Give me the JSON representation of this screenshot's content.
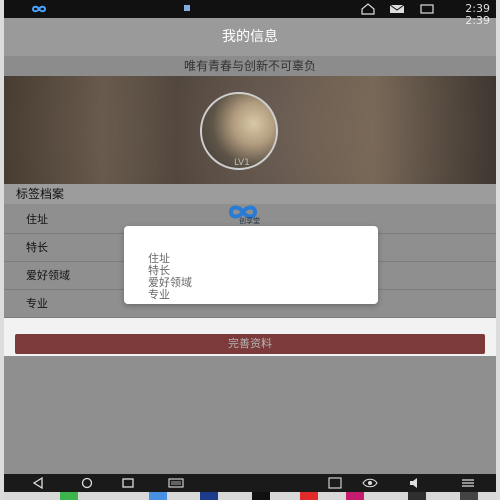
{
  "status_bar": {
    "time": "2:39"
  },
  "header": {
    "title": "我的信息",
    "subtitle_time": "2:39"
  },
  "slogan": "唯有青春与创新不可辜负",
  "profile": {
    "level": "LV1"
  },
  "tags_section": {
    "title": "标签档案",
    "rows": [
      "住址",
      "特长",
      "爱好领域",
      "专业"
    ]
  },
  "actions": {
    "complete_label": "完善资料"
  },
  "center_logo": {
    "text": "创享堂"
  },
  "dialog": {
    "items": [
      "住址",
      "特长",
      "爱好领域",
      "专业"
    ]
  },
  "icons": {
    "status": [
      "home-icon",
      "mail-icon",
      "fullscreen-icon"
    ],
    "nav": [
      "back-icon",
      "home-icon",
      "recent-icon",
      "keyboard-icon",
      "volume-icon",
      "screenshot-icon",
      "eye-icon",
      "menu-icon"
    ]
  }
}
